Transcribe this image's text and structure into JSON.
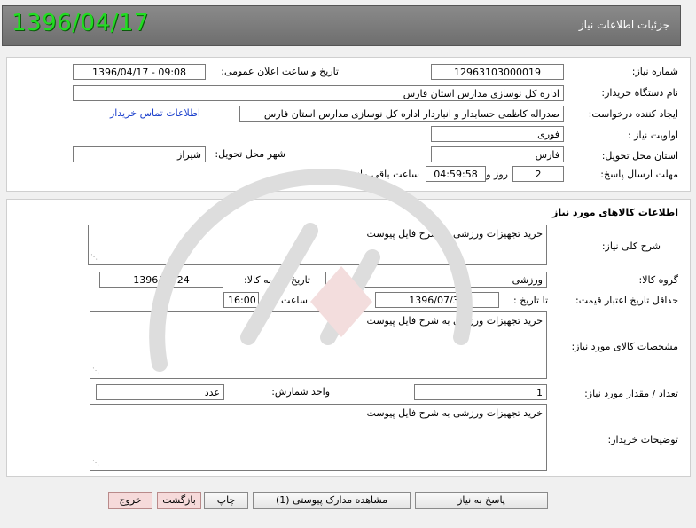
{
  "header": {
    "title": "جزئیات اطلاعات نیاز",
    "date": "1396/04/17"
  },
  "form": {
    "need_number_label": "شماره نیاز:",
    "need_number": "1296310300001​9",
    "announce_label": "تاریخ و ساعت اعلان عمومی:",
    "announce_value": "1396/04/17 - 09:08",
    "buyer_label": "نام دستگاه خریدار:",
    "buyer_value": "اداره کل نوسازی مدارس استان فارس",
    "creator_label": "ایجاد کننده درخواست:",
    "creator_value": "صدراله کاظمی حسابدار و انباردار اداره کل نوسازی مدارس استان فارس",
    "contact_link": "اطلاعات تماس خریدار",
    "priority_label": "اولویت نیاز :",
    "priority_value": "فوری",
    "province_label": "استان محل تحویل:",
    "province_value": "فارس",
    "city_label": "شهر محل تحویل:",
    "city_value": "شیراز",
    "deadline_label": "مهلت ارسال پاسخ:",
    "days_value": "2",
    "days_label": "روز و",
    "time_remaining": "04:59:58",
    "remaining_label": "ساعت باقی مانده"
  },
  "goods": {
    "section_title": "اطلاعات کالاهای مورد نیاز",
    "general_desc_label": "شرح کلی نیاز:",
    "general_desc": "خرید تجهیزات ورزشی به شرح فایل پیوست",
    "group_label": "گروه کالا:",
    "group_value": "ورزشی",
    "need_date_label": "تاریخ نیاز به کالا:",
    "need_date": "1396/04/24",
    "validity_label": "حداقل تاریخ اعتبار قیمت:",
    "until_date_label": "تا تاریخ :",
    "until_date": "1396/07/30",
    "hour_label": "ساعت :",
    "hour_value": "16:00",
    "specs_label": "مشخصات کالای مورد نیاز:",
    "specs_value": "خرید تجهیزات ورزشی به شرح فایل پیوست",
    "qty_label": "تعداد / مقدار مورد نیاز:",
    "qty_value": "1",
    "unit_label": "واحد شمارش:",
    "unit_value": "عدد",
    "buyer_notes_label": "توضیحات خریدار:",
    "buyer_notes": "خرید تجهیزات ورزشی به شرح فایل پیوست"
  },
  "buttons": {
    "reply": "پاسخ به نیاز",
    "attachments": "مشاهده مدارک پیوستی (1)",
    "print": "چاپ",
    "back": "بازگشت",
    "exit": "خروج"
  },
  "colors": {
    "header_bg": "#777777",
    "date_green": "#22dd22",
    "link_blue": "#1a3fcc",
    "soft_button": "#f6dada"
  }
}
